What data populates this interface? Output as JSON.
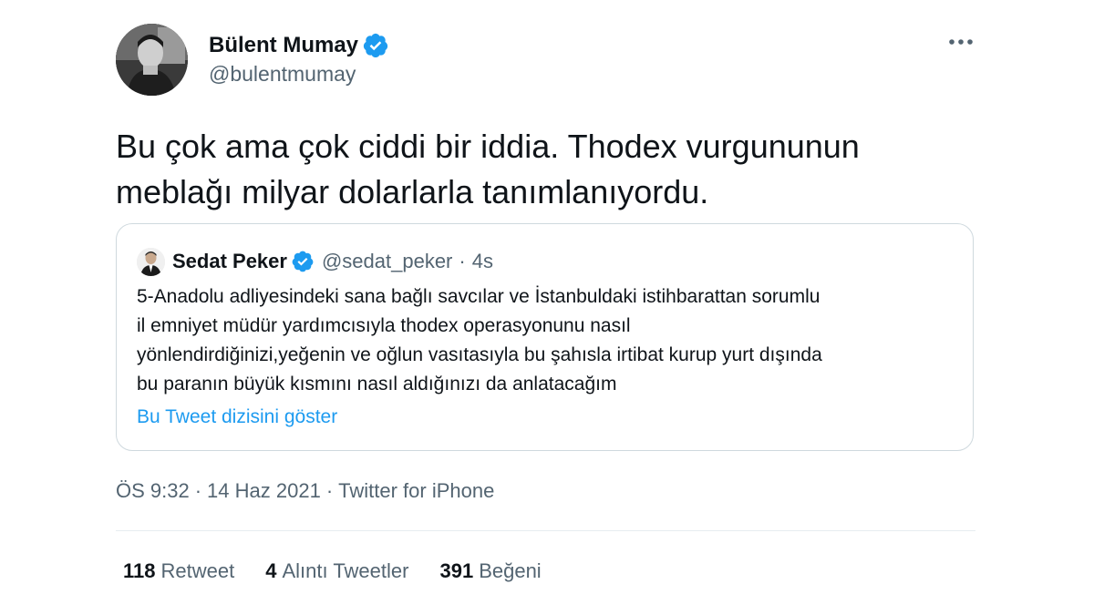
{
  "author": {
    "name": "Bülent Mumay",
    "handle": "@bulentmumay",
    "avatar_icon": "profile-photo"
  },
  "more_icon": "more-horizontal-icon",
  "tweet": {
    "text_lines": [
      "Bu çok ama çok ciddi bir iddia. Thodex vurgununun",
      "meblağı milyar dolarlarla tanımlanıyordu."
    ]
  },
  "quote": {
    "name": "Sedat Peker",
    "handle": "@sedat_peker",
    "separator": "·",
    "time": "4s",
    "body_lines": [
      "5-Anadolu adliyesindeki sana bağlı savcılar ve İstanbuldaki istihbarattan sorumlu",
      "il emniyet müdür yardımcısıyla thodex operasyonunu nasıl",
      "yönlendirdiğinizi,yeğenin ve oğlun vasıtasıyla bu şahısla irtibat kurup yurt dışında",
      "bu paranın büyük kısmını nasıl aldığınızı da anlatacağım"
    ],
    "thread_link": "Bu Tweet dizisini göster"
  },
  "meta": {
    "time": "ÖS 9:32",
    "separator": "·",
    "date": "14 Haz 2021",
    "source": "Twitter for iPhone"
  },
  "stats": {
    "retweets": {
      "count": "118",
      "label": "Retweet"
    },
    "quotes": {
      "count": "4",
      "label": "Alıntı Tweetler"
    },
    "likes": {
      "count": "391",
      "label": "Beğeni"
    }
  },
  "colors": {
    "verified": "#1d9bf0",
    "link": "#1d9bf0",
    "secondary_text": "#536471",
    "border": "#cfd9de"
  }
}
